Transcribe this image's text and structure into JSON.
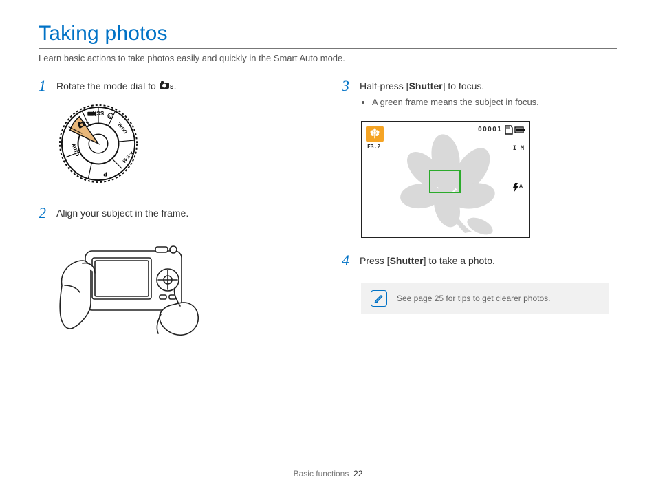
{
  "title": "Taking photos",
  "subtitle": "Learn basic actions to take photos easily and quickly in the Smart Auto mode.",
  "steps": {
    "s1": {
      "num": "1",
      "text_a": "Rotate the mode dial to ",
      "text_b": "."
    },
    "s2": {
      "num": "2",
      "text": "Align your subject in the frame."
    },
    "s3": {
      "num": "3",
      "text_a": "Half-press [",
      "bold": "Shutter",
      "text_b": "] to focus.",
      "bullet1": "A green frame means the subject in focus."
    },
    "s4": {
      "num": "4",
      "text_a": "Press [",
      "bold": "Shutter",
      "text_b": "] to take a photo."
    }
  },
  "dial": {
    "labels": [
      "SCN",
      "DUAL",
      "A·S·M",
      "P",
      "AUTO"
    ]
  },
  "lcd": {
    "f": "F3.2",
    "counter": "00001",
    "res": "I M"
  },
  "tip": {
    "text": "See page 25 for tips to get clearer photos."
  },
  "footer": {
    "section": "Basic functions",
    "page": "22"
  }
}
